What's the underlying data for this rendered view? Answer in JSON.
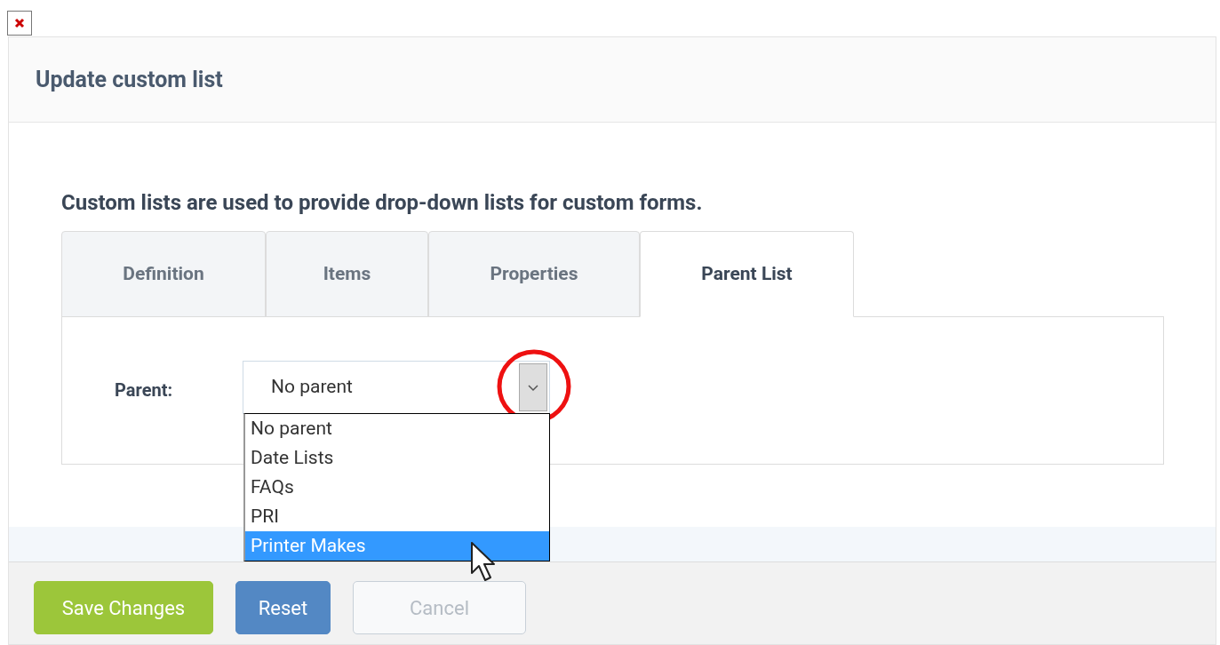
{
  "panel": {
    "title": "Update custom list"
  },
  "intro": "Custom lists are used to provide drop-down lists for custom forms.",
  "tabs": [
    {
      "label": "Definition",
      "selected": false
    },
    {
      "label": "Items",
      "selected": false
    },
    {
      "label": "Properties",
      "selected": false
    },
    {
      "label": "Parent List",
      "selected": true
    }
  ],
  "parent_field": {
    "label": "Parent:",
    "value": "No parent",
    "expanded": true,
    "options": [
      {
        "label": "No parent",
        "highlighted": false
      },
      {
        "label": "Date Lists",
        "highlighted": false
      },
      {
        "label": "FAQs",
        "highlighted": false
      },
      {
        "label": "PRI",
        "highlighted": false
      },
      {
        "label": "Printer Makes",
        "highlighted": true
      }
    ]
  },
  "buttons": [
    {
      "label": "Save Changes",
      "kind": "primary"
    },
    {
      "label": "Reset",
      "kind": "secondary"
    },
    {
      "label": "Cancel",
      "kind": "muted"
    }
  ]
}
